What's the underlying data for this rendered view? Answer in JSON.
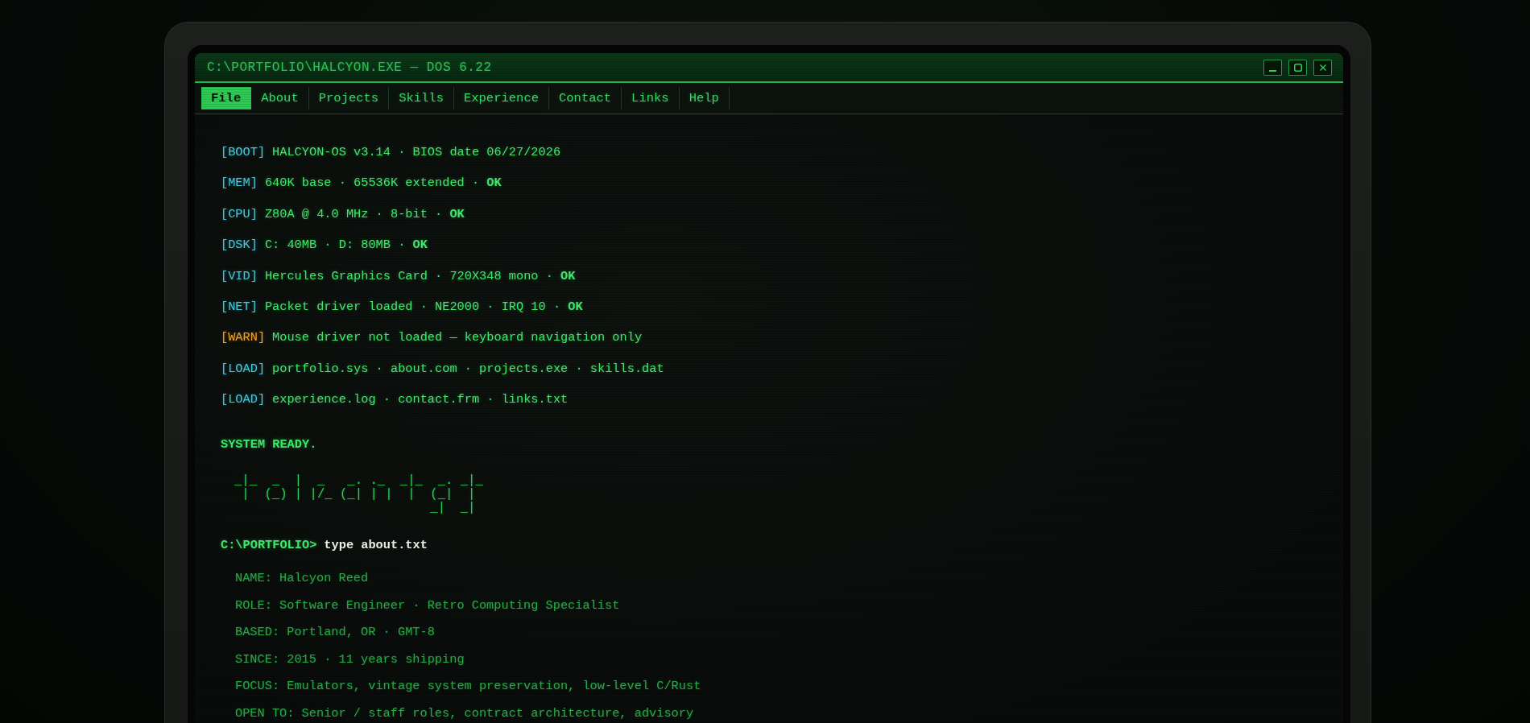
{
  "window": {
    "title": "C:\\PORTFOLIO\\HALCYON.EXE — DOS 6.22"
  },
  "menu": [
    {
      "label": "File",
      "selected": true
    },
    {
      "label": "About",
      "selected": false
    },
    {
      "label": "Projects",
      "selected": false
    },
    {
      "label": "Skills",
      "selected": false
    },
    {
      "label": "Experience",
      "selected": false
    },
    {
      "label": "Contact",
      "selected": false
    },
    {
      "label": "Links",
      "selected": false
    },
    {
      "label": "Help",
      "selected": false
    }
  ],
  "boot_log": [
    {
      "kind": "info",
      "tag": "[BOOT]",
      "text": "HALCYON-OS v3.14 · BIOS date 06/27/2026"
    },
    {
      "kind": "info",
      "tag": "[MEM]",
      "text": "640K base · 65536K extended · **OK**"
    },
    {
      "kind": "info",
      "tag": "[CPU]",
      "text": "Z80A @ 4.0 MHz · 8-bit · **OK**"
    },
    {
      "kind": "info",
      "tag": "[DSK]",
      "text": "C: 40MB · D: 80MB · **OK**"
    },
    {
      "kind": "info",
      "tag": "[VID]",
      "text": "Hercules Graphics Card · 720X348 mono · **OK**"
    },
    {
      "kind": "info",
      "tag": "[NET]",
      "text": "Packet driver loaded · NE2000 · IRQ 10 · **OK**"
    },
    {
      "kind": "warn",
      "tag": "[WARN]",
      "text": "Mouse driver not loaded — keyboard navigation only"
    },
    {
      "kind": "info",
      "tag": "[LOAD]",
      "text": "portfolio.sys · about.com · projects.exe · skills.dat"
    },
    {
      "kind": "info",
      "tag": "[LOAD]",
      "text": "experience.log · contact.frm · links.txt"
    }
  ],
  "ready": "SYSTEM READY.",
  "ascii_art": [
    "_|_  _  |  _   _. ._  _|_  _. _|_",
    " |  (_) | |/_ (_| | |  |  (_|  |",
    "                          _|  _|"
  ],
  "prompt": {
    "path": "C:\\PORTFOLIO>",
    "command": "type about.txt"
  },
  "about": [
    "NAME: Halcyon Reed",
    "ROLE: Software Engineer · Retro Computing Specialist",
    "BASED: Portland, OR · GMT-8",
    "SINCE: 2015 · 11 years shipping",
    "FOCUS: Emulators, vintage system preservation, low-level C/Rust",
    "OPEN TO: Senior / staff roles, contract architecture, advisory"
  ]
}
